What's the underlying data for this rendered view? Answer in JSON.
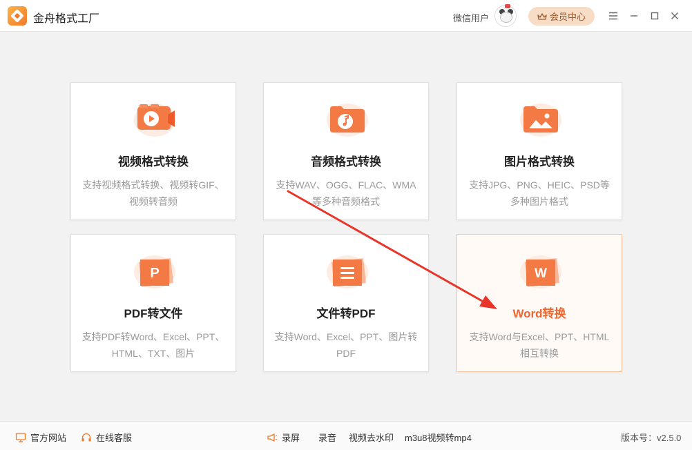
{
  "app": {
    "title": "金舟格式工厂"
  },
  "header": {
    "user_name": "微信用户",
    "vip_label": "会员中心"
  },
  "cards": [
    {
      "title": "视频格式转换",
      "desc": "支持视频格式转换、视频转GIF、视频转音频",
      "icon": "video-folder-icon"
    },
    {
      "title": "音频格式转换",
      "desc": "支持WAV、OGG、FLAC、WMA等多种音频格式",
      "icon": "audio-folder-icon"
    },
    {
      "title": "图片格式转换",
      "desc": "支持JPG、PNG、HEIC、PSD等多种图片格式",
      "icon": "image-folder-icon"
    },
    {
      "title": "PDF转文件",
      "desc": "支持PDF转Word、Excel、PPT、HTML、TXT、图片",
      "icon": "pdf-icon"
    },
    {
      "title": "文件转PDF",
      "desc": "支持Word、Excel、PPT、图片转PDF",
      "icon": "document-icon"
    },
    {
      "title": "Word转换",
      "desc": "支持Word与Excel、PPT、HTML相互转换",
      "icon": "word-icon",
      "active": true
    }
  ],
  "footer": {
    "website": "官方网站",
    "service": "在线客服",
    "record_screen": "录屏",
    "record_audio": "录音",
    "remove_watermark": "视频去水印",
    "m3u8": "m3u8视频转mp4",
    "version": "版本号：v2.5.0"
  },
  "colors": {
    "accent": "#f0652e",
    "vip_bg": "#f7dcc6",
    "arrow": "#e8352a"
  }
}
